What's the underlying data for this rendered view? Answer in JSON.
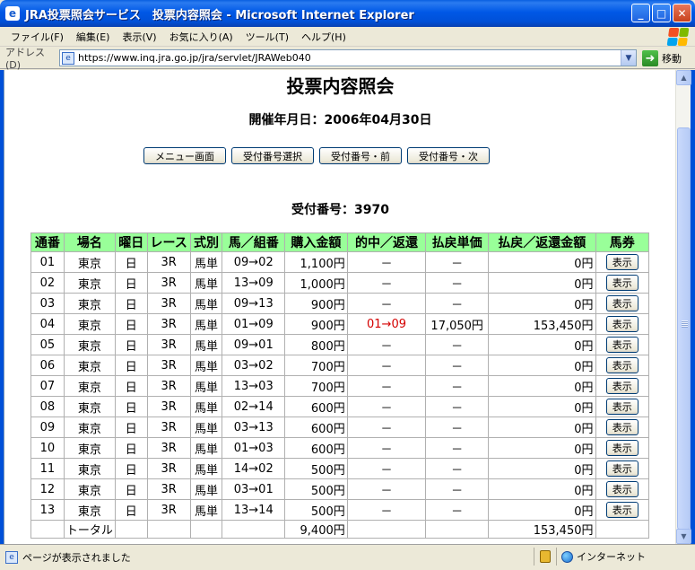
{
  "window": {
    "title": "JRA投票照会サービス　投票内容照会 - Microsoft Internet Explorer",
    "minimize_icon": "minimize-icon",
    "maximize_icon": "maximize-icon",
    "close_icon": "close-icon"
  },
  "menubar": {
    "items": [
      "ファイル(F)",
      "編集(E)",
      "表示(V)",
      "お気に入り(A)",
      "ツール(T)",
      "ヘルプ(H)"
    ]
  },
  "address": {
    "label": "アドレス(D)",
    "url": "https://www.inq.jra.go.jp/jra/servlet/JRAWeb040",
    "go_label": "移動"
  },
  "page": {
    "heading": "投票内容照会",
    "date_line": "開催年月日：2006年04月30日",
    "buttons": [
      "メニュー画面",
      "受付番号選択",
      "受付番号・前",
      "受付番号・次"
    ],
    "receipt_line": "受付番号：3970"
  },
  "table": {
    "headers": [
      "通番",
      "場名",
      "曜日",
      "レース",
      "式別",
      "馬／組番",
      "購入金額",
      "的中／返還",
      "払戻単価",
      "払戻／返還金額",
      "馬券"
    ],
    "show_label": "表示",
    "rows": [
      [
        "01",
        "東京",
        "日",
        "3R",
        "馬単",
        "09→02",
        "1,100円",
        "－",
        "－",
        "0円"
      ],
      [
        "02",
        "東京",
        "日",
        "3R",
        "馬単",
        "13→09",
        "1,000円",
        "－",
        "－",
        "0円"
      ],
      [
        "03",
        "東京",
        "日",
        "3R",
        "馬単",
        "09→13",
        "900円",
        "－",
        "－",
        "0円"
      ],
      [
        "04",
        "東京",
        "日",
        "3R",
        "馬単",
        "01→09",
        "900円",
        "01→09",
        "17,050円",
        "153,450円"
      ],
      [
        "05",
        "東京",
        "日",
        "3R",
        "馬単",
        "09→01",
        "800円",
        "－",
        "－",
        "0円"
      ],
      [
        "06",
        "東京",
        "日",
        "3R",
        "馬単",
        "03→02",
        "700円",
        "－",
        "－",
        "0円"
      ],
      [
        "07",
        "東京",
        "日",
        "3R",
        "馬単",
        "13→03",
        "700円",
        "－",
        "－",
        "0円"
      ],
      [
        "08",
        "東京",
        "日",
        "3R",
        "馬単",
        "02→14",
        "600円",
        "－",
        "－",
        "0円"
      ],
      [
        "09",
        "東京",
        "日",
        "3R",
        "馬単",
        "03→13",
        "600円",
        "－",
        "－",
        "0円"
      ],
      [
        "10",
        "東京",
        "日",
        "3R",
        "馬単",
        "01→03",
        "600円",
        "－",
        "－",
        "0円"
      ],
      [
        "11",
        "東京",
        "日",
        "3R",
        "馬単",
        "14→02",
        "500円",
        "－",
        "－",
        "0円"
      ],
      [
        "12",
        "東京",
        "日",
        "3R",
        "馬単",
        "03→01",
        "500円",
        "－",
        "－",
        "0円"
      ],
      [
        "13",
        "東京",
        "日",
        "3R",
        "馬単",
        "13→14",
        "500円",
        "－",
        "－",
        "0円"
      ]
    ],
    "hit_row_index": 3,
    "total": {
      "label": "トータル",
      "purchase": "9,400円",
      "payout": "153,450円"
    }
  },
  "status": {
    "text": "ページが表示されました",
    "zone": "インターネット"
  },
  "colors": {
    "header_bg": "#99ff99",
    "hit_text": "#d40000",
    "title_bar": "#0058e6"
  }
}
